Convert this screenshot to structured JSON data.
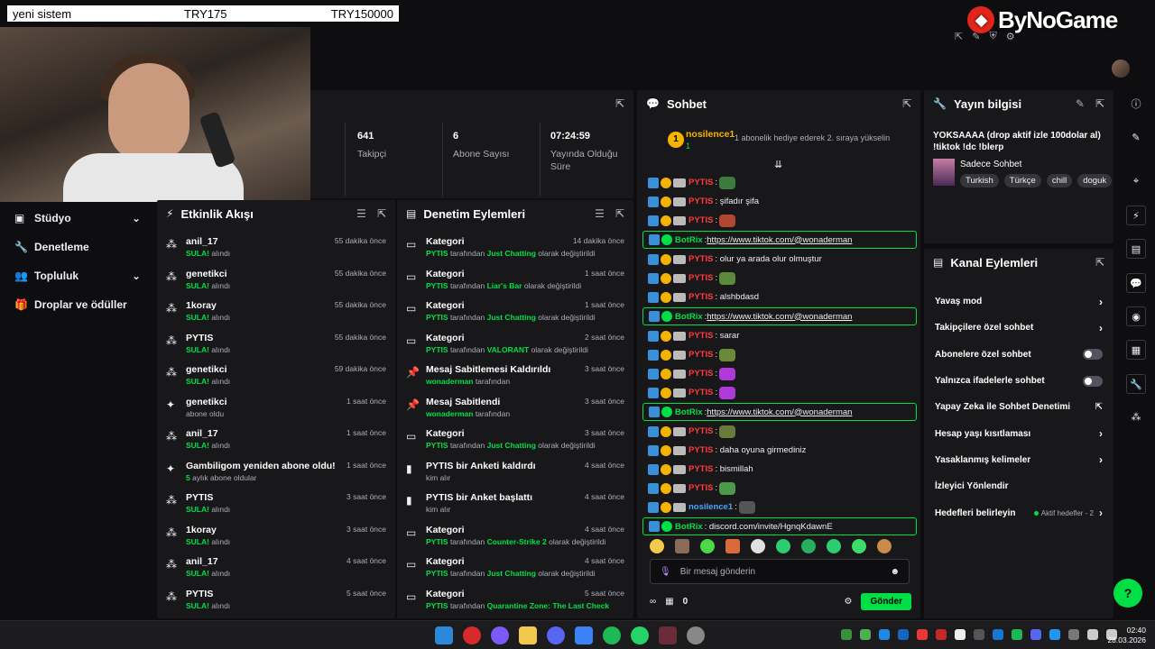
{
  "overlay": {
    "donation_name": "yeni sistem",
    "donation_amount": "TRY175",
    "donation_goal": "TRY150000",
    "logo_text": "ByNoGame"
  },
  "stats": {
    "followers_value": "641",
    "followers_label": "Takipçi",
    "subs_value": "6",
    "subs_label": "Abone Sayısı",
    "uptime_value": "07:24:59",
    "uptime_label": "Yayında Olduğu Süre"
  },
  "nav": {
    "items": [
      {
        "label": "Stüdyo",
        "icon": "studio-icon"
      },
      {
        "label": "Denetleme",
        "icon": "wrench-icon"
      },
      {
        "label": "Topluluk",
        "icon": "community-icon"
      },
      {
        "label": "Droplar ve ödüller",
        "icon": "gift-icon"
      }
    ]
  },
  "activity": {
    "title": "Etkinlik Akışı",
    "items": [
      {
        "name": "anil_17",
        "action": "SULA!",
        "suffix": "alındı",
        "time": "55 dakika önce"
      },
      {
        "name": "genetikci",
        "action": "SULA!",
        "suffix": "alındı",
        "time": "55 dakika önce"
      },
      {
        "name": "1koray",
        "action": "SULA!",
        "suffix": "alındı",
        "time": "55 dakika önce"
      },
      {
        "name": "PYTIS",
        "action": "SULA!",
        "suffix": "alındı",
        "time": "55 dakika önce"
      },
      {
        "name": "genetikci",
        "action": "SULA!",
        "suffix": "alındı",
        "time": "59 dakika önce"
      },
      {
        "name": "genetikci",
        "action": "",
        "suffix": "abone oldu",
        "time": "1 saat önce"
      },
      {
        "name": "anil_17",
        "action": "SULA!",
        "suffix": "alındı",
        "time": "1 saat önce"
      },
      {
        "name": "Gambiligom yeniden abone oldu!",
        "action": "5",
        "suffix": "aylık abone oldular",
        "time": "1 saat önce"
      },
      {
        "name": "PYTIS",
        "action": "SULA!",
        "suffix": "alındı",
        "time": "3 saat önce"
      },
      {
        "name": "1koray",
        "action": "SULA!",
        "suffix": "alındı",
        "time": "3 saat önce"
      },
      {
        "name": "anil_17",
        "action": "SULA!",
        "suffix": "alındı",
        "time": "4 saat önce"
      },
      {
        "name": "PYTIS",
        "action": "SULA!",
        "suffix": "alındı",
        "time": "5 saat önce"
      }
    ]
  },
  "moderation": {
    "title": "Denetim Eylemleri",
    "items": [
      {
        "title": "Kategori",
        "who": "PYTIS",
        "mid": "tarafından",
        "what": "Just Chatting",
        "end": "olarak değiştirildi",
        "time": "14 dakika önce"
      },
      {
        "title": "Kategori",
        "who": "PYTIS",
        "mid": "tarafından",
        "what": "Liar's Bar",
        "end": "olarak değiştirildi",
        "time": "1 saat önce"
      },
      {
        "title": "Kategori",
        "who": "PYTIS",
        "mid": "tarafından",
        "what": "Just Chatting",
        "end": "olarak değiştirildi",
        "time": "1 saat önce"
      },
      {
        "title": "Kategori",
        "who": "PYTIS",
        "mid": "tarafından",
        "what": "VALORANT",
        "end": "olarak değiştirildi",
        "time": "2 saat önce"
      },
      {
        "title": "Mesaj Sabitlemesi Kaldırıldı",
        "who": "wonaderman",
        "mid": "tarafından",
        "what": "",
        "end": "",
        "time": "3 saat önce"
      },
      {
        "title": "Mesaj Sabitlendi",
        "who": "wonaderman",
        "mid": "tarafından",
        "what": "",
        "end": "",
        "time": "3 saat önce"
      },
      {
        "title": "Kategori",
        "who": "PYTIS",
        "mid": "tarafından",
        "what": "Just Chatting",
        "end": "olarak değiştirildi",
        "time": "3 saat önce"
      },
      {
        "title": "PYTIS bir Anketi kaldırdı",
        "who": "",
        "mid": "kim alır",
        "what": "",
        "end": "",
        "time": "4 saat önce"
      },
      {
        "title": "PYTIS bir Anket başlattı",
        "who": "",
        "mid": "kim alır",
        "what": "",
        "end": "",
        "time": "4 saat önce"
      },
      {
        "title": "Kategori",
        "who": "PYTIS",
        "mid": "tarafından",
        "what": "Counter-Strike 2",
        "end": "olarak değiştirildi",
        "time": "4 saat önce"
      },
      {
        "title": "Kategori",
        "who": "PYTIS",
        "mid": "tarafından",
        "what": "Just Chatting",
        "end": "olarak değiştirildi",
        "time": "4 saat önce"
      },
      {
        "title": "Kategori",
        "who": "PYTIS",
        "mid": "tarafından",
        "what": "Quarantine Zone: The Last Check",
        "end": "",
        "time": "5 saat önce"
      }
    ]
  },
  "chat": {
    "title": "Sohbet",
    "pinned_user": "nosilence1",
    "pinned_months": "1",
    "pinned_text": "1 abonelik hediye ederek 2. sıraya yükselin",
    "input_placeholder": "Bir mesaj gönderin",
    "points": "0",
    "send_label": "Gönder",
    "messages": [
      {
        "user": "PYTIS",
        "text": ":",
        "emote": "#3d7a3d",
        "bot": false
      },
      {
        "user": "PYTIS",
        "text": ": şifadır şifa",
        "emote": "",
        "bot": false
      },
      {
        "user": "PYTIS",
        "text": ":",
        "emote": "#b0472e",
        "bot": false
      },
      {
        "user": "BotRix",
        "text": ": ",
        "link": "https://www.tiktok.com/@wonaderman",
        "bot": true
      },
      {
        "user": "PYTIS",
        "text": ": olur ya arada olur olmuştur",
        "emote": "",
        "bot": false
      },
      {
        "user": "PYTIS",
        "text": ":",
        "emote": "#5a8a3a",
        "bot": false
      },
      {
        "user": "PYTIS",
        "text": ": alshbdasd",
        "emote": "",
        "bot": false
      },
      {
        "user": "BotRix",
        "text": ": ",
        "link": "https://www.tiktok.com/@wonaderman",
        "bot": true
      },
      {
        "user": "PYTIS",
        "text": ": sarar",
        "emote": "",
        "bot": false
      },
      {
        "user": "PYTIS",
        "text": ":",
        "emote": "#6a8a3a",
        "bot": false
      },
      {
        "user": "PYTIS",
        "text": ":",
        "emote": "#b03ad9",
        "bot": false
      },
      {
        "user": "PYTIS",
        "text": ":",
        "emote": "#b03ad9",
        "bot": false
      },
      {
        "user": "BotRix",
        "text": ": ",
        "link": "https://www.tiktok.com/@wonaderman",
        "bot": true
      },
      {
        "user": "PYTIS",
        "text": ":",
        "emote": "#6a7a3a",
        "bot": false
      },
      {
        "user": "PYTIS",
        "text": ": daha oyuna girmediniz",
        "emote": "",
        "bot": false
      },
      {
        "user": "PYTIS",
        "text": ": bismillah",
        "emote": "",
        "bot": false
      },
      {
        "user": "PYTIS",
        "text": ":",
        "emote": "#4a9a4a",
        "bot": false
      },
      {
        "user": "nosilence1",
        "text": ":",
        "emote": "#555",
        "bot": false
      },
      {
        "user": "BotRix",
        "text": ": discord.com/invite/HgnqKdawnE",
        "link": "",
        "bot": true,
        "plain": true
      }
    ]
  },
  "stream_info": {
    "title": "Yayın bilgisi",
    "stream_title": "YOKSAAAA (drop aktif izle 100dolar al) !tiktok !dc !blerp",
    "category": "Sadece Sohbet",
    "tags": [
      "Turkish",
      "Türkçe",
      "chill",
      "doguk"
    ]
  },
  "channel_actions": {
    "title": "Kanal Eylemleri",
    "items": [
      {
        "label": "Yavaş mod",
        "control": "arrow"
      },
      {
        "label": "Takipçilere özel sohbet",
        "control": "arrow"
      },
      {
        "label": "Abonelere özel sohbet",
        "control": "toggle"
      },
      {
        "label": "Yalnızca ifadelerle sohbet",
        "control": "toggle"
      },
      {
        "label": "Yapay Zeka ile Sohbet Denetimi",
        "control": "external"
      },
      {
        "label": "Hesap yaşı kısıtlaması",
        "control": "arrow"
      },
      {
        "label": "Yasaklanmış kelimeler",
        "control": "arrow"
      },
      {
        "label": "İzleyici Yönlendir",
        "control": "none"
      },
      {
        "label": "Hedefleri belirleyin",
        "control": "goals",
        "extra": "Aktif hedefler - 2"
      }
    ]
  },
  "taskbar": {
    "time": "02:40",
    "date": "28.03.2026"
  },
  "colors": {
    "accent_green": "#00e046",
    "panel_bg": "#18181b",
    "page_bg": "#0e0e10",
    "pytis_red": "#ff3b3b",
    "nosilence_blue": "#4aa3ff"
  }
}
